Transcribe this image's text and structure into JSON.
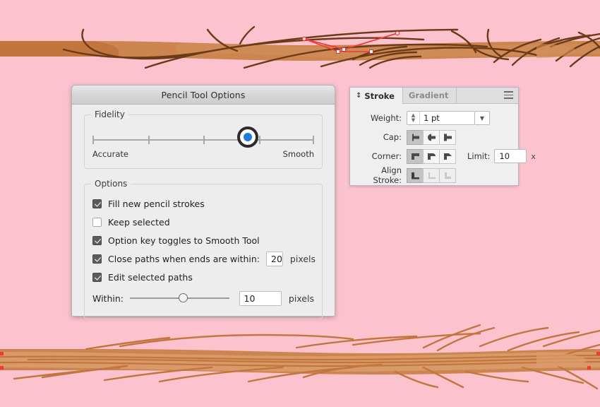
{
  "canvas": {
    "background_color": "#fcc3cf",
    "branch_fill": "#cd854f",
    "branch_fill_light": "#d99a69",
    "branch_shade": "#c97c42",
    "grain_stroke": "#6b3a17",
    "selected_path_color": "#ef3a3a",
    "anchor_fill": "#ffffff"
  },
  "dialog": {
    "title": "Pencil Tool Options",
    "fidelity": {
      "legend": "Fidelity",
      "left_label": "Accurate",
      "right_label": "Smooth",
      "value_percent": 70,
      "tick_percents": [
        0,
        25,
        50,
        75,
        100
      ],
      "knob_color": "#1f7ae0"
    },
    "options": {
      "legend": "Options",
      "checkboxes": [
        {
          "label": "Fill new pencil strokes",
          "checked": true
        },
        {
          "label": "Keep selected",
          "checked": false
        },
        {
          "label": "Option key toggles to Smooth Tool",
          "checked": true
        },
        {
          "label": "Close paths when ends are within:",
          "checked": true
        },
        {
          "label": "Edit selected paths",
          "checked": true
        }
      ],
      "close_paths_value": "20",
      "close_paths_unit": "pixels",
      "within_label": "Within:",
      "within_value": "10",
      "within_unit": "pixels",
      "within_slider_percent": 52
    }
  },
  "stroke_panel": {
    "tabs": [
      {
        "label": "Stroke",
        "active": true
      },
      {
        "label": "Gradient",
        "active": false
      }
    ],
    "menu_icon": "hamburger-icon",
    "weight": {
      "label": "Weight:",
      "value": "1 pt"
    },
    "cap": {
      "label": "Cap:",
      "options": [
        "butt-cap",
        "round-cap",
        "projecting-cap"
      ],
      "selected_index": 0
    },
    "corner": {
      "label": "Corner:",
      "options": [
        "miter-join",
        "round-join",
        "bevel-join"
      ],
      "selected_index": 0
    },
    "limit": {
      "label": "Limit:",
      "value": "10",
      "unit": "x"
    },
    "align_stroke": {
      "label": "Align Stroke:",
      "options": [
        "align-center",
        "align-inside",
        "align-outside"
      ],
      "selected_index": 0,
      "disabled_indexes": [
        1,
        2
      ]
    }
  }
}
